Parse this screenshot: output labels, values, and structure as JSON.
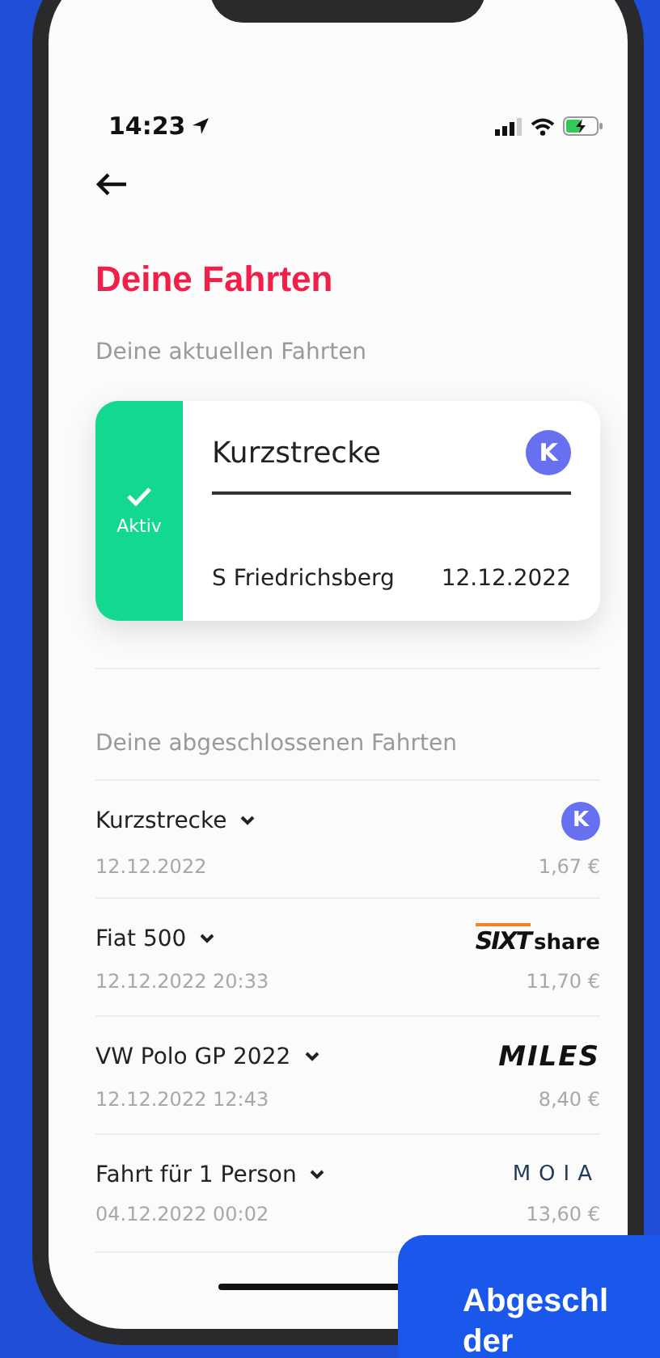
{
  "status_bar": {
    "time": "14:23"
  },
  "title": "Deine Fahrten",
  "current": {
    "heading": "Deine aktuellen Fahrten",
    "status": "Aktiv",
    "name": "Kurzstrecke",
    "badge": "K",
    "stop": "S Friedrichsberg",
    "date": "12.12.2022"
  },
  "completed": {
    "heading": "Deine abgeschlossenen Fahrten",
    "rows": [
      {
        "name": "Kurzstrecke",
        "date": "12.12.2022",
        "price": "1,67 €",
        "provider": {
          "kind": "badge",
          "parts": [
            "K"
          ]
        }
      },
      {
        "name": "Fiat 500",
        "date": "12.12.2022 20:33",
        "price": "11,70 €",
        "provider": {
          "kind": "sixt",
          "parts": [
            "SIXT",
            "share"
          ]
        }
      },
      {
        "name": "VW Polo GP 2022",
        "date": "12.12.2022 12:43",
        "price": "8,40 €",
        "provider": {
          "kind": "miles",
          "parts": [
            "MILES"
          ]
        }
      },
      {
        "name": "Fahrt für 1 Person",
        "date": "04.12.2022 00:02",
        "price": "13,60 €",
        "provider": {
          "kind": "moia",
          "parts": [
            "MOIA"
          ]
        }
      }
    ]
  },
  "callout": {
    "lines": [
      "Abgeschl",
      "der"
    ]
  }
}
